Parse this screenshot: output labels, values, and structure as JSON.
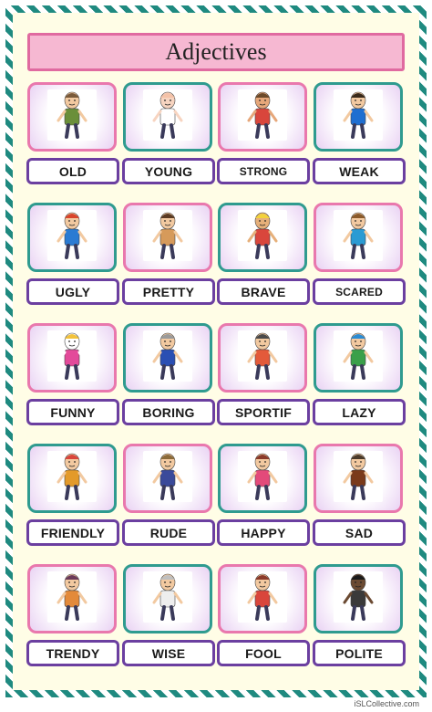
{
  "title": "Adjectives",
  "footer": "iSLCollective.com",
  "cards": [
    {
      "word": "OLD",
      "icon": "old-man-icon"
    },
    {
      "word": "YOUNG",
      "icon": "baby-icon"
    },
    {
      "word": "STRONG",
      "icon": "strong-man-icon"
    },
    {
      "word": "WEAK",
      "icon": "weak-man-icon"
    },
    {
      "word": "UGLY",
      "icon": "ugly-boy-icon"
    },
    {
      "word": "PRETTY",
      "icon": "pretty-woman-icon"
    },
    {
      "word": "BRAVE",
      "icon": "brave-warrior-icon"
    },
    {
      "word": "SCARED",
      "icon": "scared-man-icon"
    },
    {
      "word": "FUNNY",
      "icon": "clown-icon"
    },
    {
      "word": "BORING",
      "icon": "bored-man-icon"
    },
    {
      "word": "SPORTIF",
      "icon": "sporty-man-icon"
    },
    {
      "word": "LAZY",
      "icon": "lazy-man-icon"
    },
    {
      "word": "FRIENDLY",
      "icon": "friends-icon"
    },
    {
      "word": "RUDE",
      "icon": "rude-man-icon"
    },
    {
      "word": "HAPPY",
      "icon": "happy-woman-icon"
    },
    {
      "word": "SAD",
      "icon": "sad-woman-icon"
    },
    {
      "word": "TRENDY",
      "icon": "trendy-woman-icon"
    },
    {
      "word": "WISE",
      "icon": "wise-man-icon"
    },
    {
      "word": "FOOL",
      "icon": "fool-man-icon"
    },
    {
      "word": "POLITE",
      "icon": "polite-man-icon"
    }
  ],
  "colors": {
    "border_teal": "#1f8a80",
    "title_bg": "#f6b8d2",
    "card_pink": "#e978ad",
    "card_teal": "#2f9b8f",
    "label_border": "#6b3fa0",
    "page_bg": "#fffde6"
  }
}
